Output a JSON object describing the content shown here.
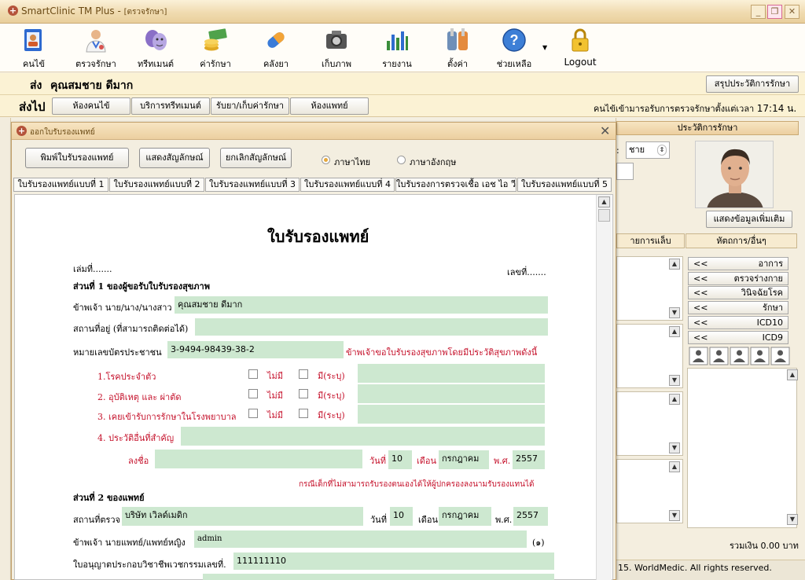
{
  "window": {
    "app_title": "SmartClinic TM Plus - ",
    "context": "[ตรวจรักษา]",
    "minimize": "_",
    "restore": "❐",
    "close": "✕"
  },
  "toolbar": {
    "items": [
      {
        "label": "คนไข้",
        "icon": "patient-icon"
      },
      {
        "label": "ตรวจรักษา",
        "icon": "doctor-icon"
      },
      {
        "label": "ทรีทเมนต์",
        "icon": "treatment-icon"
      },
      {
        "label": "ค่ารักษา",
        "icon": "money-icon"
      },
      {
        "label": "คลังยา",
        "icon": "pill-icon"
      },
      {
        "label": "เก็บภาพ",
        "icon": "camera-icon"
      },
      {
        "label": "รายงาน",
        "icon": "report-chart-icon"
      },
      {
        "label": "ตั้งค่า",
        "icon": "tools-icon"
      },
      {
        "label": "ช่วยเหลือ",
        "icon": "help-icon"
      },
      {
        "label": "Logout",
        "icon": "lock-icon"
      }
    ]
  },
  "patient_header": {
    "send_label": "ส่ง",
    "patient_name": "คุณสมชาย ดีมาก",
    "summary_button": "สรุปประวัติการรักษา"
  },
  "subheader": {
    "send_to_label": "ส่งไป",
    "buttons": [
      "ห้องคนไข้",
      "บริการทรีทเมนต์",
      "รับยา/เก็บค่ารักษา",
      "ห้องแพทย์"
    ],
    "queue_text": "คนไข้เข้ามารอรับการตรวจรักษาตั้งแต่เวลา",
    "queue_time": "17:14 น."
  },
  "right_panel": {
    "history_tab": "ประวัติการรักษา",
    "gender_prefix": ":",
    "gender_value": "ชาย",
    "more_info_button": "แสดงข้อมูลเพิ่มเติม",
    "tab_lab": "ายการแล็บ",
    "tab_appointment": "หัตถการ/อื่นๆ",
    "history_buttons": [
      {
        "arrow": "<<",
        "label": "อาการ"
      },
      {
        "arrow": "<<",
        "label": "ตรวจร่างกาย"
      },
      {
        "arrow": "<<",
        "label": "วินิจฉัยโรค"
      },
      {
        "arrow": "<<",
        "label": "รักษา"
      },
      {
        "arrow": "<<",
        "label": "ICD10"
      },
      {
        "arrow": "<<",
        "label": "ICD9"
      }
    ],
    "total": "รวมเงิน 0.00 บาท",
    "copyright": "15. WorldMedic. All rights reserved."
  },
  "dialog": {
    "title": "ออกใบรับรองแพทย์",
    "print_button": "พิมพ์ใบรับรองแพทย์",
    "show_signature_button": "แสดงสัญลักษณ์",
    "cancel_signature_button": "ยกเลิกสัญลักษณ์",
    "lang_thai": "ภาษาไทย",
    "lang_english": "ภาษาอังกฤษ",
    "tabs": [
      "ใบรับรองแพทย์แบบที่ 1",
      "ใบรับรองแพทย์แบบที่ 2",
      "ใบรับรองแพทย์แบบที่ 3",
      "ใบรับรองแพทย์แบบที่ 4",
      "ใบรับรองการตรวจเชื้อ เอช ไอ วี",
      "ใบรับรองแพทย์แบบที่ 5"
    ]
  },
  "certificate": {
    "heading": "ใบรับรองแพทย์",
    "book_no": "เล่มที่.......",
    "doc_no": "เลขที่.......",
    "part1_title": "ส่วนที่ 1 ของผู้ขอรับใบรับรองสุขภาพ",
    "applicant_label": "ข้าพเจ้า นาย/นาง/นางสาว",
    "applicant_value": "คุณสมชาย  ดีมาก",
    "address_label": "สถานที่อยู่ (ที่สามารถติดต่อได้)",
    "address_value": "",
    "idcard_label": "หมายเลขบัตรประชาชน",
    "idcard_value": "3-9494-98439-38-2",
    "request_text": "ข้าพเจ้าขอใบรับรองสุขภาพโดยมีประวัติสุขภาพดังนี้",
    "history": [
      {
        "label": "1.โรคประจำตัว",
        "no": "ไม่มี",
        "yes": "มี(ระบุ)"
      },
      {
        "label": "2. อุบัติเหตุ และ ผ่าตัด",
        "no": "ไม่มี",
        "yes": "มี(ระบุ)"
      },
      {
        "label": "3. เคยเข้ารับการรักษาในโรงพยาบาล",
        "no": "ไม่มี",
        "yes": "มี(ระบุ)"
      }
    ],
    "other_history_label": "4. ประวัติอื่นที่สำคัญ",
    "sign_label": "ลงชื่อ",
    "date_label": "วันที่",
    "month_label": "เดือน",
    "year_label": "พ.ศ.",
    "sign_day": "10",
    "sign_month": "กรกฎาคม",
    "sign_year": "2557",
    "guardian_note": "กรณีเด็กที่ไม่สามารถรับรองตนเองได้ให้ผู้ปกครองลงนามรับรองแทนได้",
    "part2_title": "ส่วนที่ 2 ของแพทย์",
    "exam_place_label": "สถานที่ตรวจ",
    "exam_place_value": "บริษัท เวิลด์เมดิก",
    "exam_day": "10",
    "exam_month": "กรกฎาคม",
    "exam_year": "2557",
    "doctor_label": "ข้าพเจ้า นายแพทย์/แพทย์หญิง",
    "doctor_value": "admin",
    "doctor_suffix": "(๑)",
    "license_label": "ใบอนุญาตประกอบวิชาชีพเวชกรรมเลขที่.",
    "license_value": "111111110"
  }
}
